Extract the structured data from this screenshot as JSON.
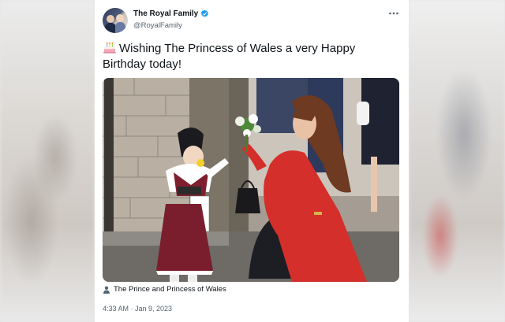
{
  "tweet": {
    "display_name": "The Royal Family",
    "handle": "@RoyalFamily",
    "text": "Wishing The Princess of Wales a very Happy Birthday today!",
    "emoji_icon": "birthday-cake-icon",
    "media_tag": "The Prince and Princess of Wales",
    "timestamp": "4:33 AM · Jan 9, 2023"
  },
  "colors": {
    "verified": "#1d9bf0",
    "secondary_text": "#536471",
    "coat_red": "#d42f2a"
  }
}
